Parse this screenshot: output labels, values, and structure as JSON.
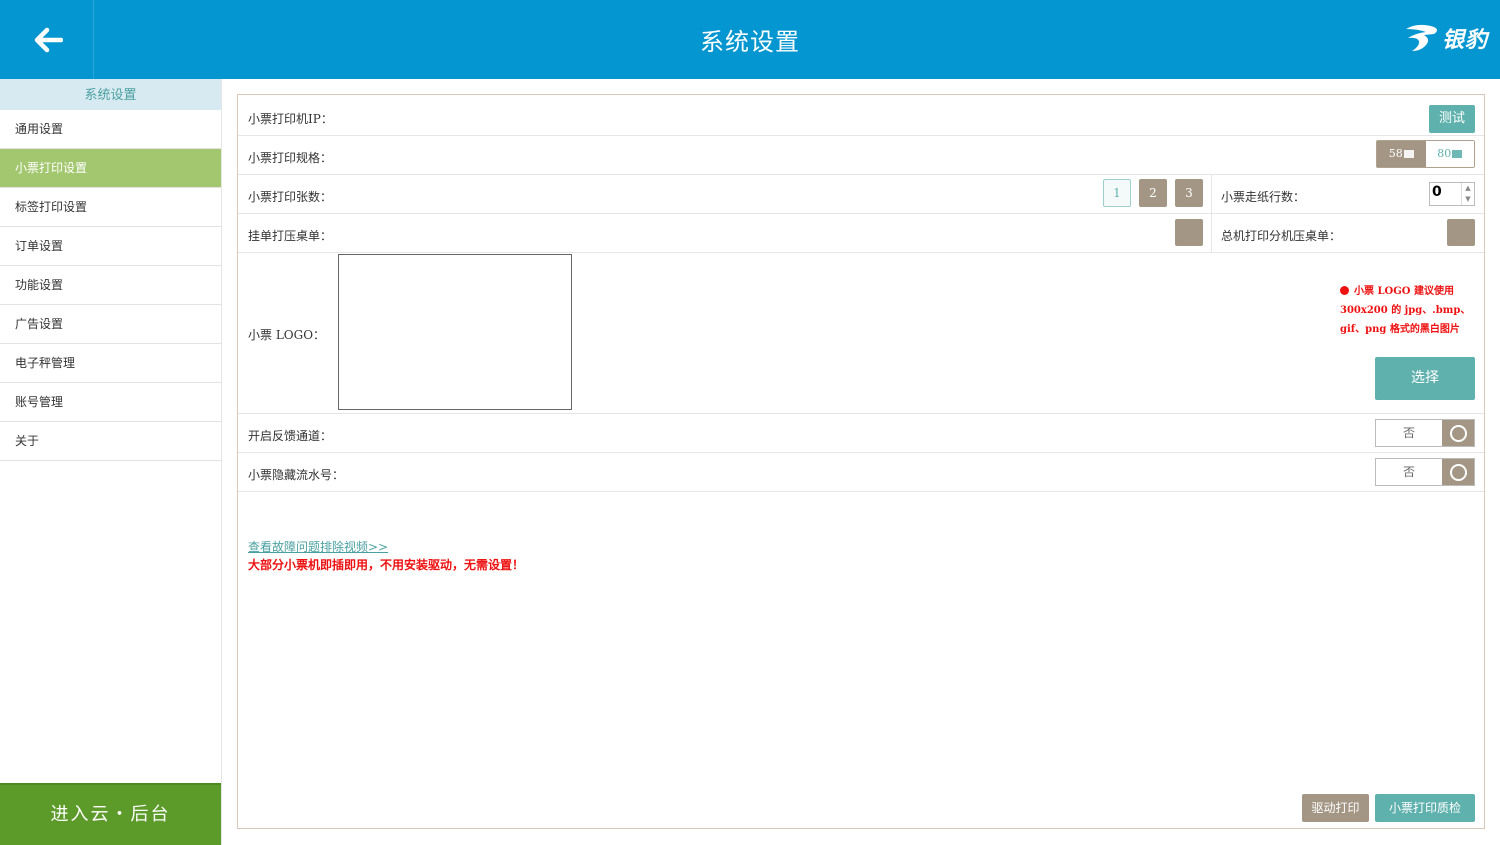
{
  "header": {
    "title": "系统设置",
    "brand": "银豹"
  },
  "sidebar": {
    "title": "系统设置",
    "items": [
      {
        "label": "通用设置"
      },
      {
        "label": "小票打印设置"
      },
      {
        "label": "标签打印设置"
      },
      {
        "label": "订单设置"
      },
      {
        "label": "功能设置"
      },
      {
        "label": "广告设置"
      },
      {
        "label": "电子秤管理"
      },
      {
        "label": "账号管理"
      },
      {
        "label": "关于"
      }
    ],
    "active_index": 1,
    "cloud_button": "进入云・后台"
  },
  "form": {
    "printer_ip": {
      "label": "小票打印机IP：",
      "test_button": "测试"
    },
    "paper_spec": {
      "label": "小票打印规格：",
      "option_58": "58",
      "option_80": "80",
      "selected": "58"
    },
    "print_count": {
      "label": "小票打印张数：",
      "options": [
        "1",
        "2",
        "3"
      ],
      "selected": "1"
    },
    "feed_lines": {
      "label": "小票走纸行数：",
      "value": "0"
    },
    "hang_order_print": {
      "label": "挂单打压桌单："
    },
    "master_print": {
      "label": "总机打印分机压桌单："
    },
    "logo": {
      "label": "小票 LOGO：",
      "note_line1": "小票 LOGO 建议使用",
      "note_line2": "300x200 的 jpg、.bmp、",
      "note_line3": "gif、png 格式的黑白图片",
      "choose_button": "选择"
    },
    "feedback_channel": {
      "label": "开启反馈通道：",
      "value": "否"
    },
    "hide_serial": {
      "label": "小票隐藏流水号：",
      "value": "否"
    }
  },
  "help": {
    "video_link": "查看故障问题排除视频>>",
    "warning": "大部分小票机即插即用，不用安装驱动，无需设置！"
  },
  "footer": {
    "driver_button": "驱动打印",
    "qc_button": "小票打印质检"
  },
  "colors": {
    "header": "#0396d0",
    "teal": "#5fb1ad",
    "taupe": "#a39684",
    "active_green": "#a2c76e",
    "cloud_green": "#5c9b2a",
    "warning_red": "#ee1111"
  }
}
